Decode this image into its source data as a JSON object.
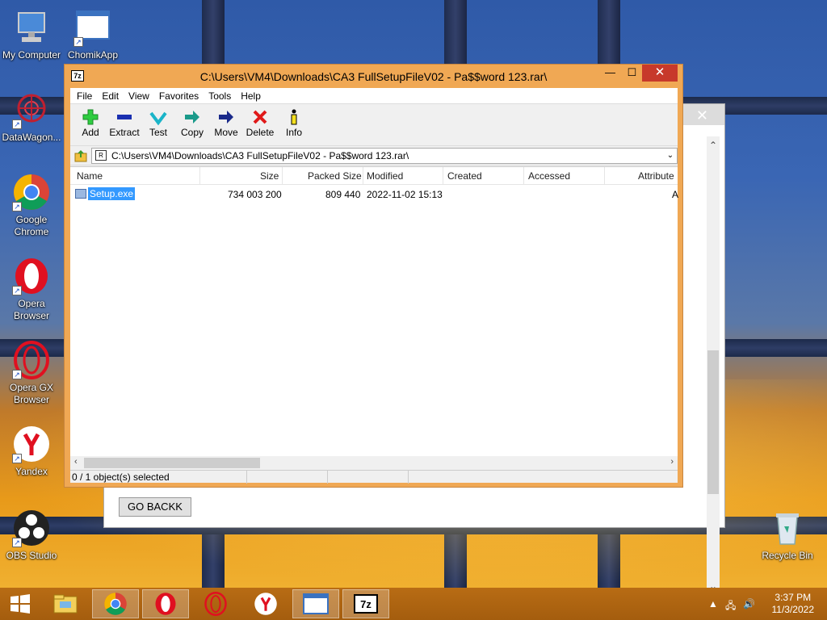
{
  "desktop": {
    "icons": [
      {
        "label": "My Computer",
        "icon": "computer-icon"
      },
      {
        "label": "ChomikApp",
        "icon": "window-icon"
      },
      {
        "label": "DataWagon...",
        "icon": "datawagon-icon"
      },
      {
        "label": "Google Chrome",
        "icon": "chrome-icon"
      },
      {
        "label": "Opera Browser",
        "icon": "opera-icon"
      },
      {
        "label": "Opera GX Browser",
        "icon": "opera-gx-icon"
      },
      {
        "label": "Yandex",
        "icon": "yandex-icon"
      },
      {
        "label": "OBS Studio",
        "icon": "obs-icon"
      },
      {
        "label": "Recycle Bin",
        "icon": "recycle-bin-icon"
      }
    ]
  },
  "background_window": {
    "go_back_label": "GO BACKK"
  },
  "zip_window": {
    "title": "C:\\Users\\VM4\\Downloads\\CA3 FullSetupFileV02 - Pa$$word 123.rar\\",
    "menu": [
      "File",
      "Edit",
      "View",
      "Favorites",
      "Tools",
      "Help"
    ],
    "toolbar": [
      {
        "label": "Add",
        "icon": "add-icon"
      },
      {
        "label": "Extract",
        "icon": "extract-icon"
      },
      {
        "label": "Test",
        "icon": "test-icon"
      },
      {
        "label": "Copy",
        "icon": "copy-icon"
      },
      {
        "label": "Move",
        "icon": "move-icon"
      },
      {
        "label": "Delete",
        "icon": "delete-icon"
      },
      {
        "label": "Info",
        "icon": "info-icon"
      }
    ],
    "address": "C:\\Users\\VM4\\Downloads\\CA3 FullSetupFileV02 - Pa$$word 123.rar\\",
    "columns": [
      "Name",
      "Size",
      "Packed Size",
      "Modified",
      "Created",
      "Accessed",
      "Attribute"
    ],
    "rows": [
      {
        "name": "Setup.exe",
        "size": "734 003 200",
        "packed_size": "809 440",
        "modified": "2022-11-02 15:13",
        "created": "",
        "accessed": "",
        "attributes": "A"
      }
    ],
    "status": "0 / 1 object(s) selected"
  },
  "taskbar": {
    "time": "3:37 PM",
    "date": "11/3/2022",
    "buttons": [
      "start-button",
      "file-explorer",
      "chrome",
      "opera",
      "opera-gx",
      "yandex",
      "window",
      "7zip"
    ]
  }
}
